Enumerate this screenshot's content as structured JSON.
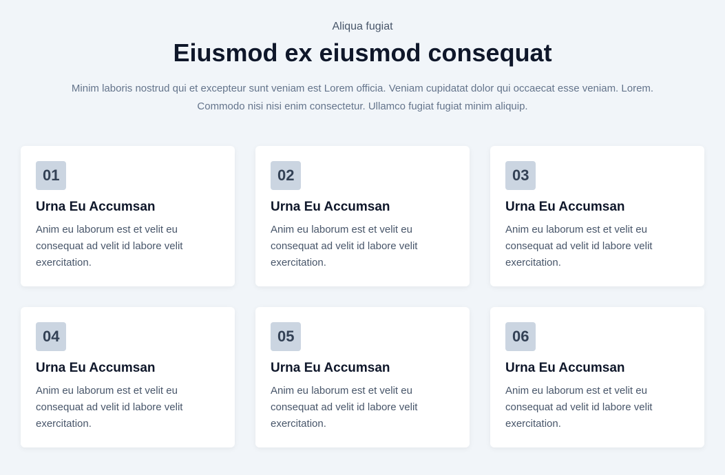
{
  "header": {
    "subtitle": "Aliqua fugiat",
    "title": "Eiusmod ex eiusmod consequat",
    "description": "Minim laboris nostrud qui et excepteur sunt veniam est Lorem officia. Veniam cupidatat dolor qui occaecat esse veniam. Lorem. Commodo nisi nisi enim consectetur. Ullamco fugiat fugiat minim aliquip."
  },
  "cards": [
    {
      "number": "01",
      "title": "Urna Eu Accumsan",
      "text": "Anim eu laborum est et velit eu consequat ad velit id labore velit exercitation."
    },
    {
      "number": "02",
      "title": "Urna Eu Accumsan",
      "text": "Anim eu laborum est et velit eu consequat ad velit id labore velit exercitation."
    },
    {
      "number": "03",
      "title": "Urna Eu Accumsan",
      "text": "Anim eu laborum est et velit eu consequat ad velit id labore velit exercitation."
    },
    {
      "number": "04",
      "title": "Urna Eu Accumsan",
      "text": "Anim eu laborum est et velit eu consequat ad velit id labore velit exercitation."
    },
    {
      "number": "05",
      "title": "Urna Eu Accumsan",
      "text": "Anim eu laborum est et velit eu consequat ad velit id labore velit exercitation."
    },
    {
      "number": "06",
      "title": "Urna Eu Accumsan",
      "text": "Anim eu laborum est et velit eu consequat ad velit id labore velit exercitation."
    }
  ]
}
